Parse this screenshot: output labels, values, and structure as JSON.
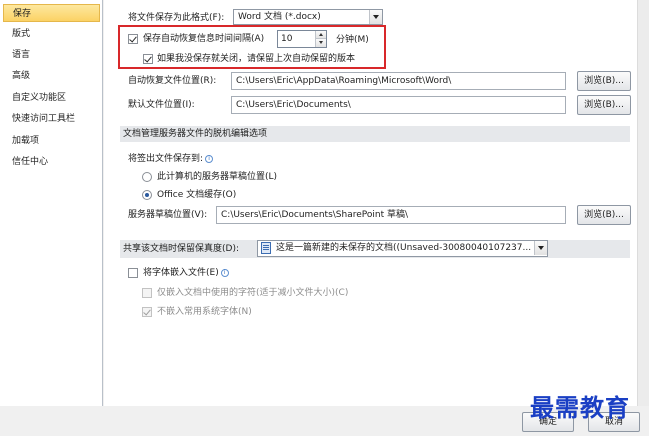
{
  "sidebar": {
    "items": [
      {
        "label": "保存"
      },
      {
        "label": "版式"
      },
      {
        "label": "语言"
      },
      {
        "label": "高级"
      },
      {
        "label": "自定义功能区"
      },
      {
        "label": "快速访问工具栏"
      },
      {
        "label": "加载项"
      },
      {
        "label": "信任中心"
      }
    ]
  },
  "save": {
    "format_label": "将文件保存为此格式(F):",
    "format_value": "Word 文档 (*.docx)",
    "autorecover_label": "保存自动恢复信息时间间隔(A)",
    "autorecover_value": "10",
    "minutes_label": "分钟(M)",
    "keep_last_label": "如果我没保存就关闭，请保留上次自动保留的版本",
    "autorecover_location_label": "自动恢复文件位置(R):",
    "autorecover_location_value": "C:\\Users\\Eric\\AppData\\Roaming\\Microsoft\\Word\\",
    "default_location_label": "默认文件位置(I):",
    "default_location_value": "C:\\Users\\Eric\\Documents\\",
    "browse_label": "浏览(B)..."
  },
  "offline": {
    "header": "文档管理服务器文件的脱机编辑选项",
    "save_to_label": "将签出文件保存到:",
    "option_server": "此计算机的服务器草稿位置(L)",
    "option_cache": "Office 文档缓存(O)",
    "drafts_label": "服务器草稿位置(V):",
    "drafts_value": "C:\\Users\\Eric\\Documents\\SharePoint 草稿\\",
    "browse_label": "浏览(B)..."
  },
  "fidelity": {
    "header": "共享该文档时保留保真度(D):",
    "doc_value": "这是一篇新建的未保存的文档((Unsaved-30080040107237...",
    "embed_fonts_label": "将字体嵌入文件(E)",
    "embed_used_label": "仅嵌入文档中使用的字符(适于减小文件大小)(C)",
    "no_common_label": "不嵌入常用系统字体(N)"
  },
  "footer": {
    "ok_label": "确定",
    "cancel_label": "取消"
  },
  "watermark": "最需教育",
  "colors": {
    "highlight_border": "#d8282a",
    "selected_nav": "#fbd265",
    "watermark": "#1a3fc4"
  }
}
